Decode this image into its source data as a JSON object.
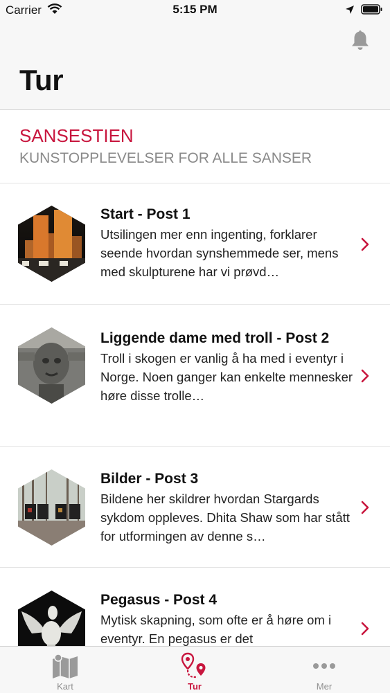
{
  "status_bar": {
    "carrier": "Carrier",
    "time": "5:15 PM"
  },
  "header": {
    "title": "Tur"
  },
  "section": {
    "title": "SANSESTIEN",
    "subtitle": "KUNSTOPPLEVELSER FOR ALLE SANSER"
  },
  "posts": [
    {
      "title": "Start - Post 1",
      "desc": "Utsilingen mer enn ingenting, forklarer seende hvordan synshemmede ser, mens med skulpturene har vi prøvd…"
    },
    {
      "title": "Liggende dame med troll - Post 2",
      "desc": "Troll i skogen er vanlig å ha med i eventyr i Norge. Noen ganger kan enkelte mennesker høre disse trolle…"
    },
    {
      "title": "Bilder - Post 3",
      "desc": "Bildene her skildrer hvordan Stargards sykdom oppleves. Dhita Shaw som har stått for utformingen av denne s…"
    },
    {
      "title": "Pegasus - Post 4",
      "desc": "Mytisk skapning, som ofte er å høre om i eventyr. En pegasus er det"
    }
  ],
  "tabs": [
    {
      "label": "Kart",
      "icon": "map-icon"
    },
    {
      "label": "Tur",
      "icon": "route-pins-icon"
    },
    {
      "label": "Mer",
      "icon": "more-dots-icon"
    }
  ],
  "colors": {
    "accent": "#c8163e",
    "muted": "#8e8e8e",
    "bar_bg": "#f7f7f7"
  }
}
